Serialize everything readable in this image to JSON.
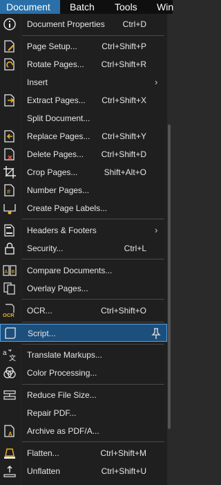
{
  "menubar": {
    "document": "Document",
    "batch": "Batch",
    "tools": "Tools",
    "window": "Win"
  },
  "menu": {
    "document_properties": {
      "label": "Document Properties",
      "shortcut": "Ctrl+D"
    },
    "page_setup": {
      "label": "Page Setup...",
      "shortcut": "Ctrl+Shift+P"
    },
    "rotate_pages": {
      "label": "Rotate Pages...",
      "shortcut": "Ctrl+Shift+R"
    },
    "insert": {
      "label": "Insert",
      "submenu": "›"
    },
    "extract_pages": {
      "label": "Extract Pages...",
      "shortcut": "Ctrl+Shift+X"
    },
    "split_document": {
      "label": "Split Document..."
    },
    "replace_pages": {
      "label": "Replace Pages...",
      "shortcut": "Ctrl+Shift+Y"
    },
    "delete_pages": {
      "label": "Delete Pages...",
      "shortcut": "Ctrl+Shift+D"
    },
    "crop_pages": {
      "label": "Crop Pages...",
      "shortcut": "Shift+Alt+O"
    },
    "number_pages": {
      "label": "Number Pages..."
    },
    "create_page_labels": {
      "label": "Create Page Labels..."
    },
    "headers_footers": {
      "label": "Headers & Footers",
      "submenu": "›"
    },
    "security": {
      "label": "Security...",
      "shortcut": "Ctrl+L"
    },
    "compare_documents": {
      "label": "Compare Documents..."
    },
    "overlay_pages": {
      "label": "Overlay Pages..."
    },
    "ocr": {
      "label": "OCR...",
      "shortcut": "Ctrl+Shift+O"
    },
    "script": {
      "label": "Script..."
    },
    "translate_markups": {
      "label": "Translate Markups..."
    },
    "color_processing": {
      "label": "Color Processing..."
    },
    "reduce_file_size": {
      "label": "Reduce File Size..."
    },
    "repair_pdf": {
      "label": "Repair PDF..."
    },
    "archive_pdfa": {
      "label": "Archive as PDF/A..."
    },
    "flatten": {
      "label": "Flatten...",
      "shortcut": "Ctrl+Shift+M"
    },
    "unflatten": {
      "label": "Unflatten",
      "shortcut": "Ctrl+Shift+U"
    }
  },
  "colors": {
    "accent": "#2a6fa8",
    "selected": "#1d4f7c",
    "icon_yellow": "#e8b22a"
  }
}
